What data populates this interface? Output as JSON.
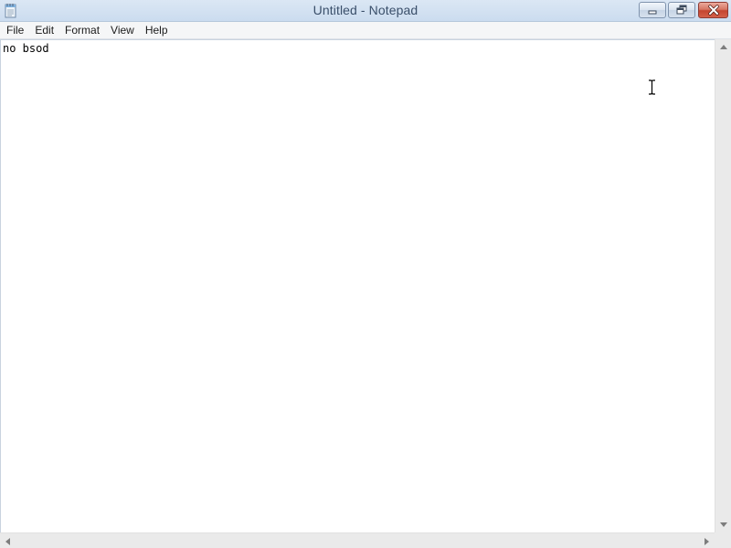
{
  "window": {
    "title": "Untitled - Notepad"
  },
  "menu": {
    "items": [
      "File",
      "Edit",
      "Format",
      "View",
      "Help"
    ]
  },
  "editor": {
    "content": "no bsod"
  },
  "icons": {
    "app": "notepad-icon",
    "minimize": "minimize-icon",
    "maximize": "restore-icon",
    "close": "close-icon",
    "cursor": "ibeam-cursor-icon",
    "scroll_up": "arrow-up-icon",
    "scroll_down": "arrow-down-icon",
    "scroll_left": "arrow-left-icon",
    "scroll_right": "arrow-right-icon"
  },
  "colors": {
    "titlebar": "#cbdcef",
    "title_text": "#3a4f6a",
    "close_button": "#c44530"
  }
}
